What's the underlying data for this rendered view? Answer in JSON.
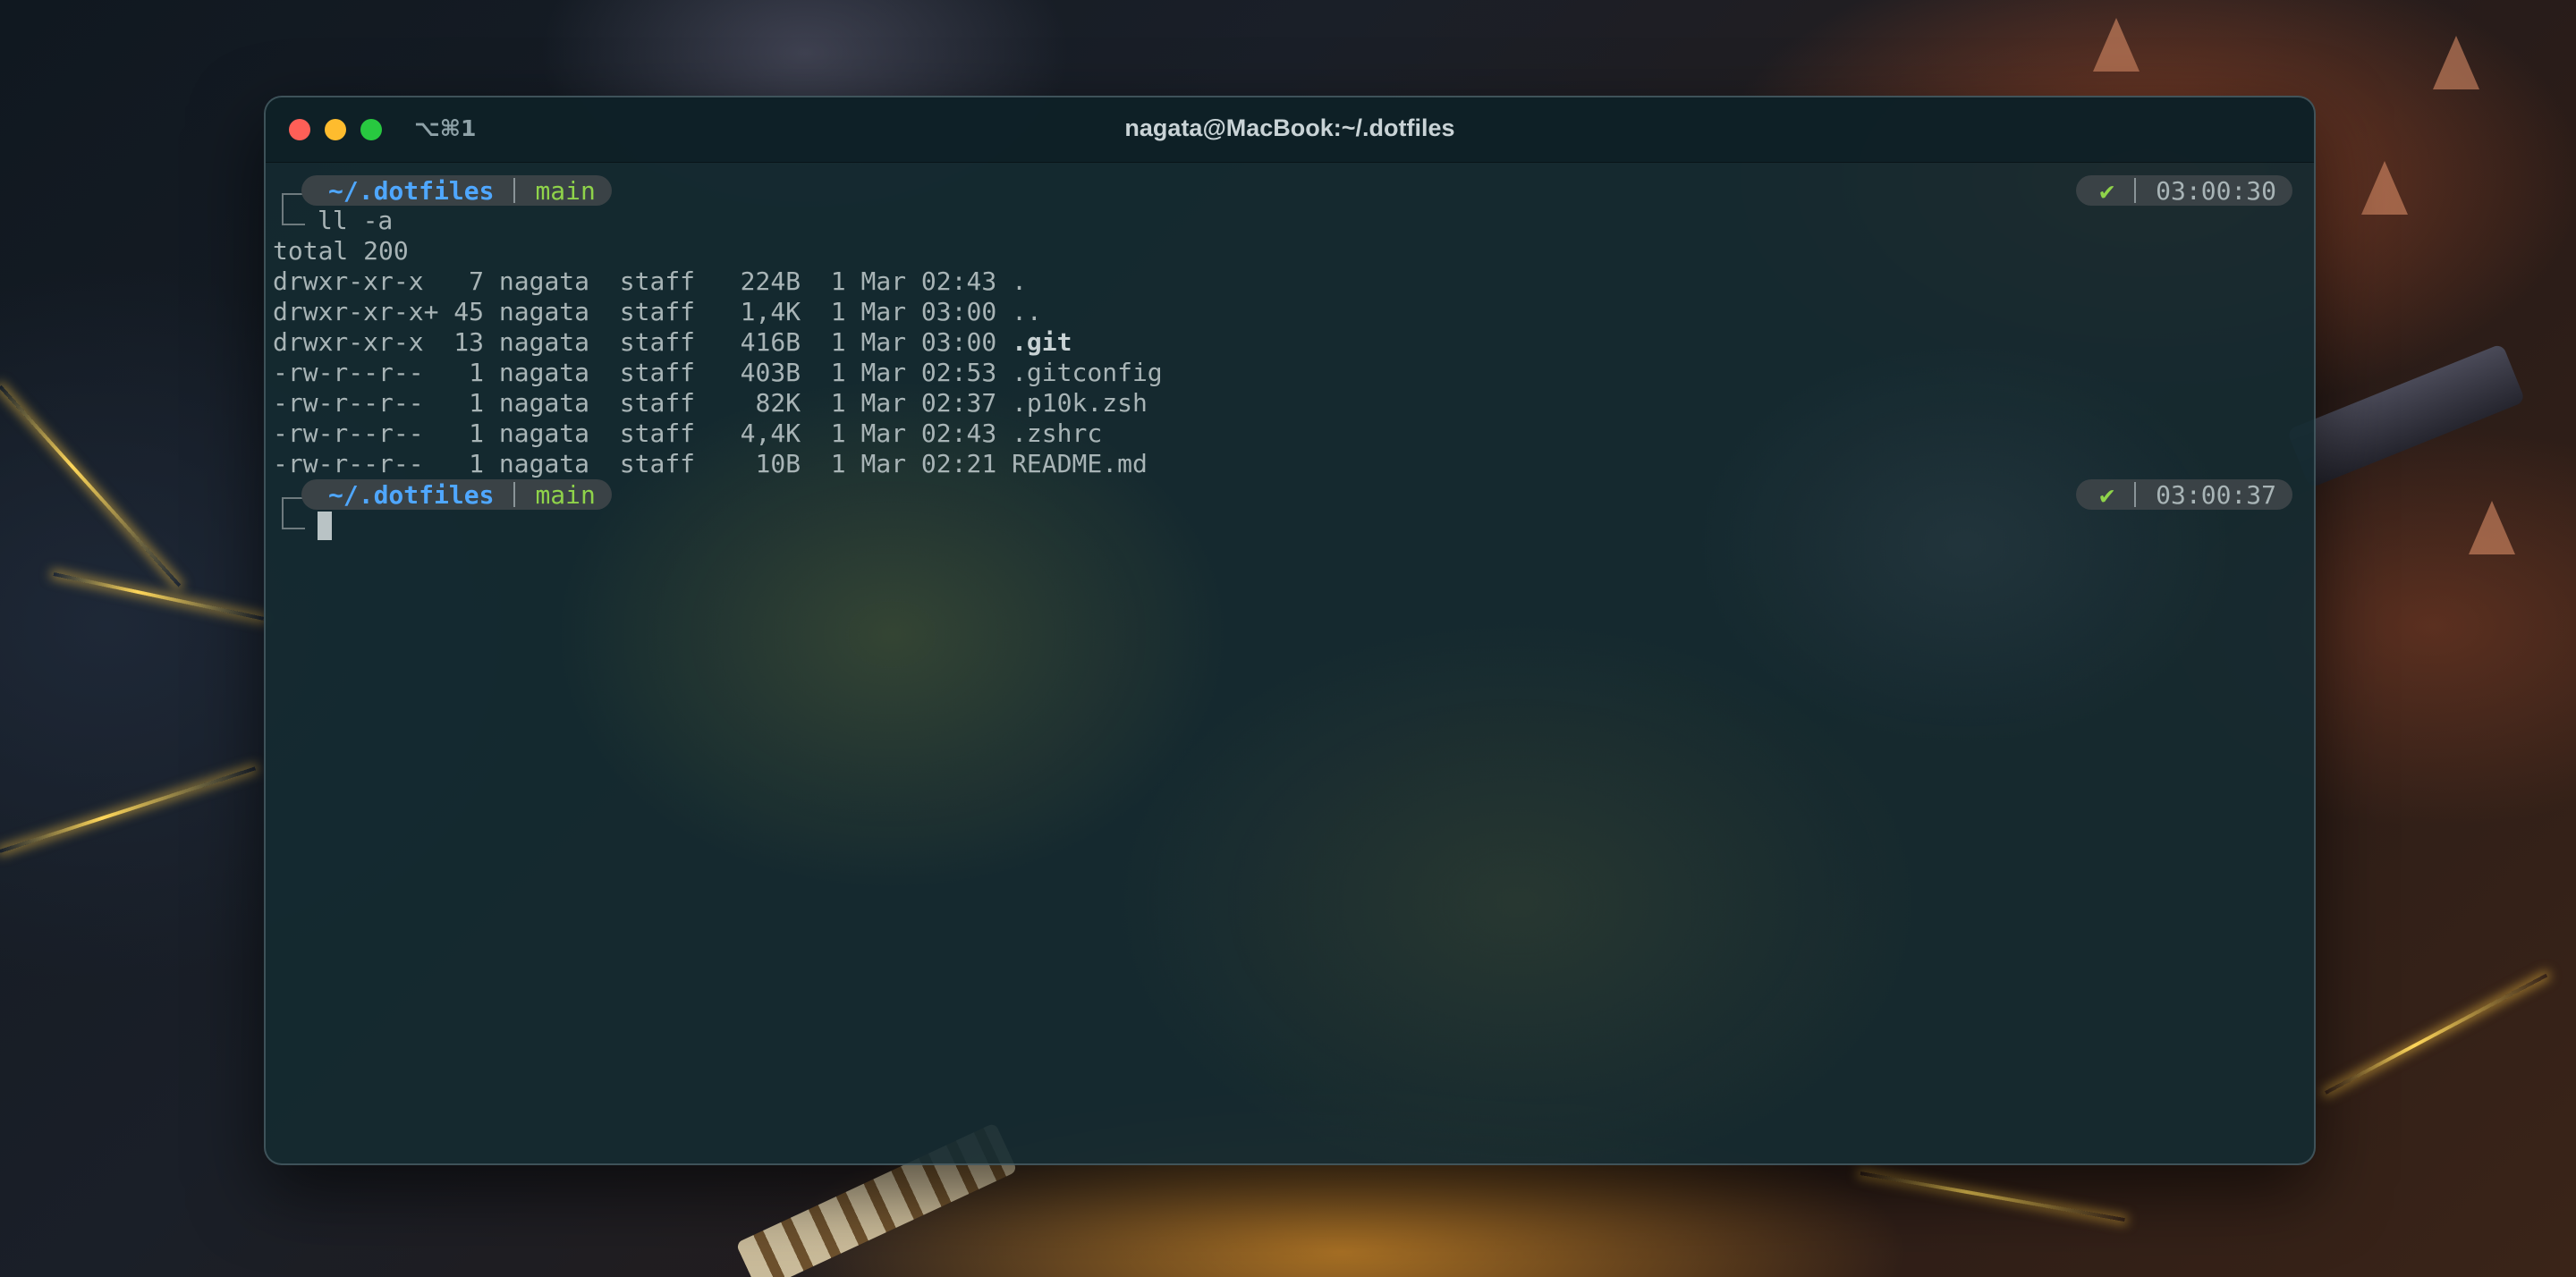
{
  "window": {
    "shortcut": "⌥⌘1",
    "title": "nagata@MacBook:~/.dotfiles"
  },
  "prompts": [
    {
      "dir": "~/.dotfiles",
      "branch": "main",
      "status": "✔",
      "time": "03:00:30",
      "command": "ll -a"
    },
    {
      "dir": "~/.dotfiles",
      "branch": "main",
      "status": "✔",
      "time": "03:00:37",
      "command": ""
    }
  ],
  "output": {
    "total": "total 200",
    "rows": [
      {
        "perms": "drwxr-xr-x ",
        "links": " 7",
        "user": "nagata",
        "group": "staff",
        "size": "224B",
        "date": "1 Mar 02:43",
        "name": ".",
        "bold": false
      },
      {
        "perms": "drwxr-xr-x+",
        "links": "45",
        "user": "nagata",
        "group": "staff",
        "size": "1,4K",
        "date": "1 Mar 03:00",
        "name": "..",
        "bold": false
      },
      {
        "perms": "drwxr-xr-x ",
        "links": "13",
        "user": "nagata",
        "group": "staff",
        "size": "416B",
        "date": "1 Mar 03:00",
        "name": ".git",
        "bold": true
      },
      {
        "perms": "-rw-r--r-- ",
        "links": " 1",
        "user": "nagata",
        "group": "staff",
        "size": "403B",
        "date": "1 Mar 02:53",
        "name": ".gitconfig",
        "bold": false
      },
      {
        "perms": "-rw-r--r-- ",
        "links": " 1",
        "user": "nagata",
        "group": "staff",
        "size": " 82K",
        "date": "1 Mar 02:37",
        "name": ".p10k.zsh",
        "bold": false
      },
      {
        "perms": "-rw-r--r-- ",
        "links": " 1",
        "user": "nagata",
        "group": "staff",
        "size": "4,4K",
        "date": "1 Mar 02:43",
        "name": ".zshrc",
        "bold": false
      },
      {
        "perms": "-rw-r--r-- ",
        "links": " 1",
        "user": "nagata",
        "group": "staff",
        "size": " 10B",
        "date": "1 Mar 02:21",
        "name": "README.md",
        "bold": false
      }
    ]
  },
  "colors": {
    "dir": "#4fa7ff",
    "branch": "#8fd34a",
    "status_ok": "#8fd34a",
    "text": "#a8b4b6"
  }
}
